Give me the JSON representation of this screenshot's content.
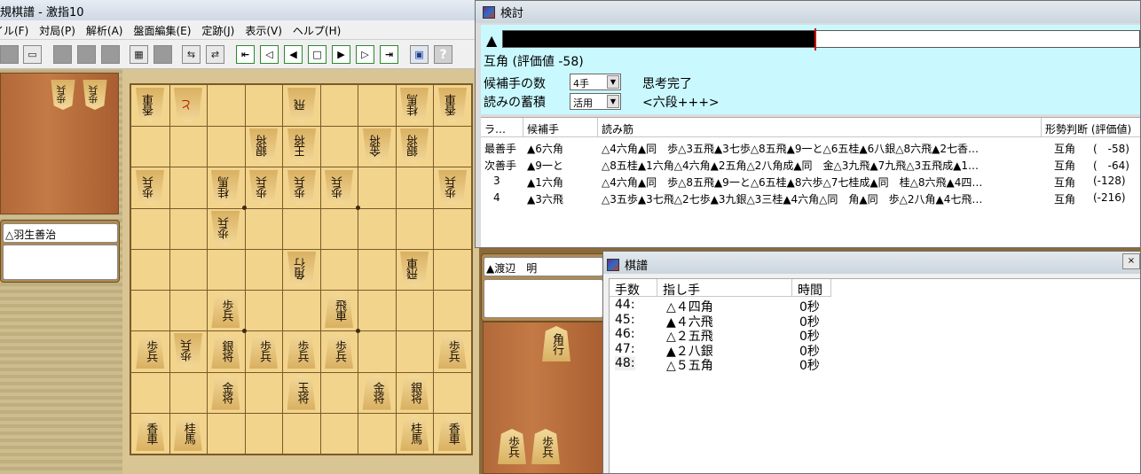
{
  "main_window": {
    "title": "規棋譜 - 激指10",
    "menu": [
      "イル(F)",
      "対局(P)",
      "解析(A)",
      "盤面編集(E)",
      "定跡(J)",
      "表示(V)",
      "ヘルプ(H)"
    ]
  },
  "players": {
    "white_name": "△羽生善治",
    "black_name": "▲渡辺　明"
  },
  "analysis": {
    "title": "検討",
    "eval_marker": "▲",
    "eval_fraction": 0.49,
    "eval_text": "互角 (評価値 -58)",
    "cand_label": "候補手の数",
    "cand_value": "4手",
    "thinking_status": "思考完了",
    "accum_label": "読みの蓄積",
    "accum_value": "活用",
    "level_text": "<六段+++>",
    "headers": [
      "ラ…",
      "候補手",
      "読み筋",
      "形勢判断 (評価値)"
    ],
    "rows": [
      {
        "rank": "最善手",
        "move": "▲6六角",
        "pv": "△4六角▲同　歩△3五飛▲3七歩△8五飛▲9一と△6五桂▲6八銀△8六飛▲2七香…",
        "judge": "互角",
        "value": "(　-58)"
      },
      {
        "rank": "次善手",
        "move": "▲9一と",
        "pv": "△8五桂▲1六角△4六角▲2五角△2八角成▲同　金△3九飛▲7九飛△3五飛成▲1…",
        "judge": "互角",
        "value": "(　-64)"
      },
      {
        "rank": "3",
        "move": "▲1六角",
        "pv": "△4六角▲同　歩△8五飛▲9一と△6五桂▲8六歩△7七桂成▲同　桂△8六飛▲4四…",
        "judge": "互角",
        "value": "(-128)"
      },
      {
        "rank": "4",
        "move": "▲3六飛",
        "pv": "△3五歩▲3七飛△2七歩▲3九銀△3三桂▲4六角△同　角▲同　歩△2八角▲4七飛…",
        "judge": "互角",
        "value": "(-216)"
      }
    ]
  },
  "kifu": {
    "title": "棋譜",
    "close_label": "×",
    "headers": [
      "手数",
      "指し手",
      "時間"
    ],
    "moves": [
      {
        "num": "44:",
        "move": "△４四角",
        "time": "0秒"
      },
      {
        "num": "45:",
        "move": "▲４六飛",
        "time": "0秒"
      },
      {
        "num": "46:",
        "move": "△２五飛",
        "time": "0秒"
      },
      {
        "num": "47:",
        "move": "▲２八銀",
        "time": "0秒"
      },
      {
        "num": "48:",
        "move": "△５五角",
        "time": "0秒"
      }
    ]
  },
  "board": {
    "pieces": [
      {
        "file": 9,
        "rank": 1,
        "side": "gote",
        "name": "香車"
      },
      {
        "file": 8,
        "rank": 1,
        "side": "gote",
        "name": "と",
        "red": true
      },
      {
        "file": 5,
        "rank": 1,
        "side": "gote",
        "name": "飛"
      },
      {
        "file": 2,
        "rank": 1,
        "side": "gote",
        "name": "桂馬"
      },
      {
        "file": 1,
        "rank": 1,
        "side": "gote",
        "name": "香車"
      },
      {
        "file": 6,
        "rank": 2,
        "side": "gote",
        "name": "銀将"
      },
      {
        "file": 5,
        "rank": 2,
        "side": "gote",
        "name": "王将"
      },
      {
        "file": 3,
        "rank": 2,
        "side": "gote",
        "name": "金将"
      },
      {
        "file": 2,
        "rank": 2,
        "side": "gote",
        "name": "銀将"
      },
      {
        "file": 9,
        "rank": 3,
        "side": "gote",
        "name": "歩兵"
      },
      {
        "file": 7,
        "rank": 3,
        "side": "gote",
        "name": "桂馬"
      },
      {
        "file": 6,
        "rank": 3,
        "side": "gote",
        "name": "歩兵"
      },
      {
        "file": 5,
        "rank": 3,
        "side": "gote",
        "name": "歩兵"
      },
      {
        "file": 4,
        "rank": 3,
        "side": "gote",
        "name": "歩兵"
      },
      {
        "file": 1,
        "rank": 3,
        "side": "gote",
        "name": "歩兵"
      },
      {
        "file": 7,
        "rank": 4,
        "side": "gote",
        "name": "歩兵"
      },
      {
        "file": 5,
        "rank": 5,
        "side": "gote",
        "name": "角行"
      },
      {
        "file": 2,
        "rank": 5,
        "side": "gote",
        "name": "飛車"
      },
      {
        "file": 7,
        "rank": 6,
        "side": "sente",
        "name": "歩兵"
      },
      {
        "file": 4,
        "rank": 6,
        "side": "sente",
        "name": "飛車"
      },
      {
        "file": 9,
        "rank": 7,
        "side": "sente",
        "name": "歩兵"
      },
      {
        "file": 8,
        "rank": 7,
        "side": "gote",
        "name": "歩兵"
      },
      {
        "file": 7,
        "rank": 7,
        "side": "sente",
        "name": "銀将"
      },
      {
        "file": 6,
        "rank": 7,
        "side": "sente",
        "name": "歩兵"
      },
      {
        "file": 5,
        "rank": 7,
        "side": "sente",
        "name": "歩兵"
      },
      {
        "file": 4,
        "rank": 7,
        "side": "sente",
        "name": "歩兵"
      },
      {
        "file": 1,
        "rank": 7,
        "side": "sente",
        "name": "歩兵"
      },
      {
        "file": 7,
        "rank": 8,
        "side": "sente",
        "name": "金将"
      },
      {
        "file": 5,
        "rank": 8,
        "side": "sente",
        "name": "玉将"
      },
      {
        "file": 3,
        "rank": 8,
        "side": "sente",
        "name": "金将"
      },
      {
        "file": 2,
        "rank": 8,
        "side": "sente",
        "name": "銀将"
      },
      {
        "file": 9,
        "rank": 9,
        "side": "sente",
        "name": "香車"
      },
      {
        "file": 8,
        "rank": 9,
        "side": "sente",
        "name": "桂馬"
      },
      {
        "file": 2,
        "rank": 9,
        "side": "sente",
        "name": "桂馬"
      },
      {
        "file": 1,
        "rank": 9,
        "side": "sente",
        "name": "香車"
      }
    ],
    "white_hand": [
      "歩兵",
      "歩兵"
    ],
    "black_hand": [
      "角行",
      "歩兵",
      "歩兵"
    ]
  },
  "icons": {
    "toolbar": [
      "new-icon",
      "open-icon",
      "save-icon",
      "print-icon",
      "undo-icon",
      "copy-icon",
      "paste-icon",
      "board-icon",
      "flip-icon",
      "edit-icon",
      "first-icon",
      "back10-icon",
      "back-icon",
      "stop-icon",
      "forward-icon",
      "forward10-icon",
      "last-icon",
      "screen-icon",
      "help-icon"
    ]
  }
}
